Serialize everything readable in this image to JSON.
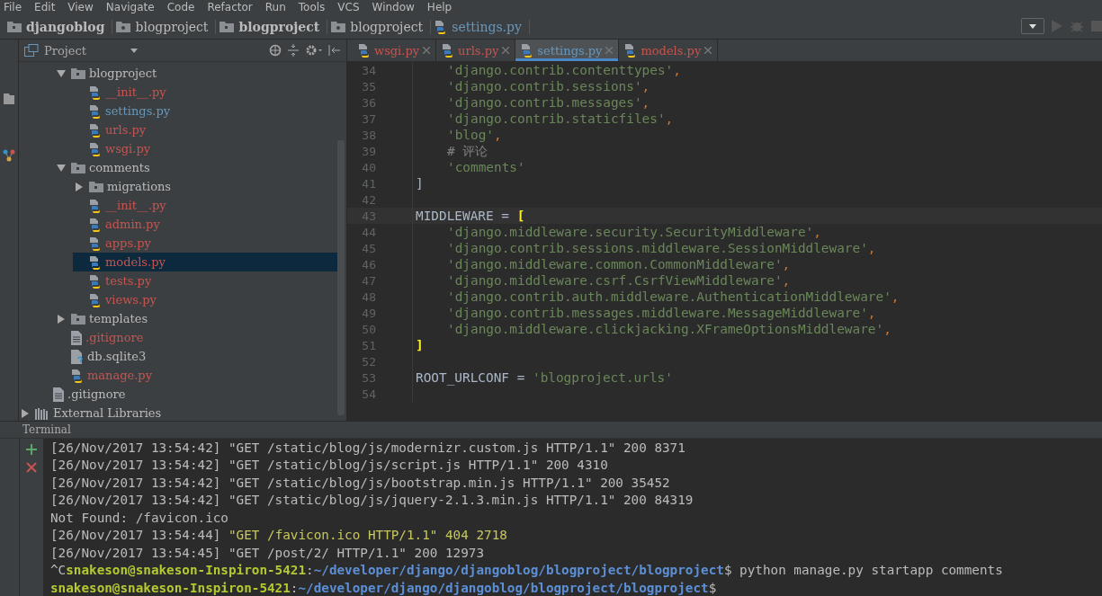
{
  "menu": [
    "File",
    "Edit",
    "View",
    "Navigate",
    "Code",
    "Refactor",
    "Run",
    "Tools",
    "VCS",
    "Window",
    "Help"
  ],
  "breadcrumbs": [
    {
      "label": "djangoblog",
      "kind": "folder",
      "bold": true
    },
    {
      "label": "blogproject",
      "kind": "module",
      "bold": false
    },
    {
      "label": "blogproject",
      "kind": "folder",
      "bold": true
    },
    {
      "label": "blogproject",
      "kind": "module",
      "bold": false
    },
    {
      "label": "settings.py",
      "kind": "python",
      "bold": false
    }
  ],
  "project_panel": {
    "title": "Project",
    "tree": [
      {
        "children": [
          {
            "children": [
              {
                "label": "blogproject",
                "kind": "folder",
                "expanded": true,
                "selected": false,
                "color": "#bbbbbb",
                "children": [
                  {
                    "label": "__init__.py",
                    "kind": "python",
                    "selected": false,
                    "color": "#c75450"
                  },
                  {
                    "label": "settings.py",
                    "kind": "python",
                    "selected": false,
                    "color": "#6897bb"
                  },
                  {
                    "label": "urls.py",
                    "kind": "python",
                    "selected": false,
                    "color": "#c75450"
                  },
                  {
                    "label": "wsgi.py",
                    "kind": "python",
                    "selected": false,
                    "color": "#c75450"
                  }
                ]
              },
              {
                "label": "comments",
                "kind": "folder",
                "expanded": true,
                "selected": false,
                "color": "#bbbbbb",
                "children": [
                  {
                    "label": "migrations",
                    "kind": "folder",
                    "expanded": false,
                    "selected": false,
                    "color": "#bbbbbb"
                  },
                  {
                    "label": "__init__.py",
                    "kind": "python",
                    "selected": false,
                    "color": "#c75450"
                  },
                  {
                    "label": "admin.py",
                    "kind": "python",
                    "selected": false,
                    "color": "#c75450"
                  },
                  {
                    "label": "apps.py",
                    "kind": "python",
                    "selected": false,
                    "color": "#c75450"
                  },
                  {
                    "label": "models.py",
                    "kind": "python",
                    "selected": true,
                    "color": "#c75450"
                  },
                  {
                    "label": "tests.py",
                    "kind": "python",
                    "selected": false,
                    "color": "#c75450"
                  },
                  {
                    "label": "views.py",
                    "kind": "python",
                    "selected": false,
                    "color": "#c75450"
                  }
                ]
              },
              {
                "label": "templates",
                "kind": "folder",
                "expanded": false,
                "selected": false,
                "color": "#bbbbbb"
              },
              {
                "label": ".gitignore",
                "kind": "text",
                "selected": false,
                "color": "#c75450"
              },
              {
                "label": "db.sqlite3",
                "kind": "unknown",
                "selected": false,
                "color": "#bbbbbb"
              },
              {
                "label": "manage.py",
                "kind": "python",
                "selected": false,
                "color": "#c75450"
              }
            ]
          },
          {
            "label": ".gitignore",
            "kind": "text",
            "selected": false,
            "color": "#bbbbbb"
          }
        ]
      },
      {
        "label": "External Libraries",
        "kind": "library",
        "expanded": false,
        "selected": false,
        "color": "#bbbbbb"
      }
    ]
  },
  "tabs": [
    {
      "label": "wsgi.py",
      "selected": false,
      "color": "#c75450"
    },
    {
      "label": "urls.py",
      "selected": false,
      "color": "#c75450"
    },
    {
      "label": "settings.py",
      "selected": true,
      "color": "#6897bb"
    },
    {
      "label": "models.py",
      "selected": false,
      "color": "#c75450"
    }
  ],
  "code": [
    {
      "number": "34",
      "indented": true,
      "tokens": [
        {
          "kind": "string",
          "text": "'django.contrib.contenttypes'"
        },
        {
          "kind": "punct",
          "text": ","
        }
      ]
    },
    {
      "number": "35",
      "indented": true,
      "tokens": [
        {
          "kind": "string",
          "text": "'django.contrib.sessions'"
        },
        {
          "kind": "punct",
          "text": ","
        }
      ]
    },
    {
      "number": "36",
      "indented": true,
      "tokens": [
        {
          "kind": "string",
          "text": "'django.contrib.messages'"
        },
        {
          "kind": "punct",
          "text": ","
        }
      ]
    },
    {
      "number": "37",
      "indented": true,
      "tokens": [
        {
          "kind": "string",
          "text": "'django.contrib.staticfiles'"
        },
        {
          "kind": "punct",
          "text": ","
        }
      ]
    },
    {
      "number": "38",
      "indented": true,
      "tokens": [
        {
          "kind": "string",
          "text": "'blog'"
        },
        {
          "kind": "punct",
          "text": ","
        }
      ]
    },
    {
      "number": "39",
      "indented": true,
      "tokens": [
        {
          "kind": "comment",
          "text": "# 评论"
        }
      ]
    },
    {
      "number": "40",
      "indented": true,
      "tokens": [
        {
          "kind": "string",
          "text": "'comments'"
        }
      ]
    },
    {
      "number": "41",
      "indented": false,
      "tokens": [
        {
          "kind": "plain",
          "text": "]"
        }
      ]
    },
    {
      "number": "42"
    },
    {
      "number": "43",
      "indented": false,
      "tokens": [
        {
          "kind": "plain",
          "text": "MIDDLEWARE = "
        },
        {
          "kind": "brace",
          "text": "["
        }
      ]
    },
    {
      "number": "44",
      "indented": true,
      "tokens": [
        {
          "kind": "string",
          "text": "'django.middleware.security.SecurityMiddleware'"
        },
        {
          "kind": "punct",
          "text": ","
        }
      ]
    },
    {
      "number": "45",
      "indented": true,
      "tokens": [
        {
          "kind": "string",
          "text": "'django.contrib.sessions.middleware.SessionMiddleware'"
        },
        {
          "kind": "punct",
          "text": ","
        }
      ]
    },
    {
      "number": "46",
      "indented": true,
      "tokens": [
        {
          "kind": "string",
          "text": "'django.middleware.common.CommonMiddleware'"
        },
        {
          "kind": "punct",
          "text": ","
        }
      ]
    },
    {
      "number": "47",
      "indented": true,
      "tokens": [
        {
          "kind": "string",
          "text": "'django.middleware.csrf.CsrfViewMiddleware'"
        },
        {
          "kind": "punct",
          "text": ","
        }
      ]
    },
    {
      "number": "48",
      "indented": true,
      "tokens": [
        {
          "kind": "string",
          "text": "'django.contrib.auth.middleware.AuthenticationMiddleware'"
        },
        {
          "kind": "punct",
          "text": ","
        }
      ]
    },
    {
      "number": "49",
      "indented": true,
      "tokens": [
        {
          "kind": "string",
          "text": "'django.contrib.messages.middleware.MessageMiddleware'"
        },
        {
          "kind": "punct",
          "text": ","
        }
      ]
    },
    {
      "number": "50",
      "indented": true,
      "tokens": [
        {
          "kind": "string",
          "text": "'django.middleware.clickjacking.XFrameOptionsMiddleware'"
        },
        {
          "kind": "punct",
          "text": ","
        }
      ]
    },
    {
      "number": "51",
      "indented": false,
      "tokens": [
        {
          "kind": "brace",
          "text": "]"
        }
      ]
    },
    {
      "number": "52"
    },
    {
      "number": "53",
      "indented": false,
      "tokens": [
        {
          "kind": "plain",
          "text": "ROOT_URLCONF = "
        },
        {
          "kind": "string",
          "text": "'blogproject.urls'"
        }
      ]
    },
    {
      "number": "54"
    }
  ],
  "terminal": {
    "title": "Terminal",
    "lines": [
      [
        {
          "kind": "plain",
          "text": "[26/Nov/2017 13:54:42] \"GET /static/blog/js/modernizr.custom.js HTTP/1.1\" 200 8371"
        }
      ],
      [
        {
          "kind": "plain",
          "text": "[26/Nov/2017 13:54:42] \"GET /static/blog/js/script.js HTTP/1.1\" 200 4310"
        }
      ],
      [
        {
          "kind": "plain",
          "text": "[26/Nov/2017 13:54:42] \"GET /static/blog/js/bootstrap.min.js HTTP/1.1\" 200 35452"
        }
      ],
      [
        {
          "kind": "plain",
          "text": "[26/Nov/2017 13:54:42] \"GET /static/blog/js/jquery-2.1.3.min.js HTTP/1.1\" 200 84319"
        }
      ],
      [
        {
          "kind": "plain",
          "text": "Not Found: /favicon.ico"
        }
      ],
      [
        {
          "kind": "plain",
          "text": "[26/Nov/2017 13:54:44] "
        },
        {
          "kind": "warn",
          "text": "\"GET /favicon.ico HTTP/1.1\" 404 2718"
        }
      ],
      [
        {
          "kind": "plain",
          "text": "[26/Nov/2017 13:54:45] \"GET /post/2/ HTTP/1.1\" 200 12973"
        }
      ],
      [
        {
          "kind": "plain",
          "text": "^C"
        },
        {
          "kind": "user",
          "text": "snakeson@snakeson-Inspiron-5421"
        },
        {
          "kind": "plain",
          "text": ":"
        },
        {
          "kind": "path",
          "text": "~/developer/django/djangoblog/blogproject/blogproject"
        },
        {
          "kind": "plain",
          "text": "$ python manage.py startapp comments"
        }
      ],
      [
        {
          "kind": "user",
          "text": "snakeson@snakeson-Inspiron-5421"
        },
        {
          "kind": "plain",
          "text": ":"
        },
        {
          "kind": "path",
          "text": "~/developer/django/djangoblog/blogproject/blogproject"
        },
        {
          "kind": "plain",
          "text": "$"
        }
      ]
    ]
  }
}
